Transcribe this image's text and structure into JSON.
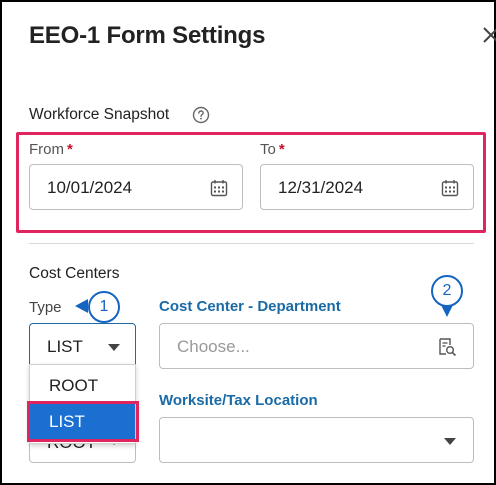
{
  "dialog": {
    "title": "EEO-1 Form Settings",
    "close_icon": "close-icon"
  },
  "workforce_snapshot": {
    "label": "Workforce Snapshot",
    "help_icon": "help-circle-icon",
    "from": {
      "label": "From",
      "required_mark": "*",
      "value": "10/01/2024",
      "icon": "calendar-icon"
    },
    "to": {
      "label": "To",
      "required_mark": "*",
      "value": "12/31/2024",
      "icon": "calendar-icon"
    }
  },
  "cost_centers": {
    "label": "Cost Centers",
    "type": {
      "label": "Type",
      "value": "LIST",
      "options": [
        "ROOT",
        "LIST"
      ],
      "highlighted_option": "LIST",
      "behind_text": "ROOT"
    },
    "department": {
      "label": "Cost Center - Department",
      "placeholder": "Choose...",
      "icon": "lookup-icon"
    },
    "worksite": {
      "label": "Worksite/Tax Location",
      "value": ""
    }
  },
  "callouts": [
    "1",
    "2"
  ],
  "colors": {
    "highlight": "#e0245e",
    "accent_blue": "#1a6aa6",
    "badge_blue": "#1565c0",
    "selected_option": "#1a6fd1",
    "required": "#c8102e"
  }
}
